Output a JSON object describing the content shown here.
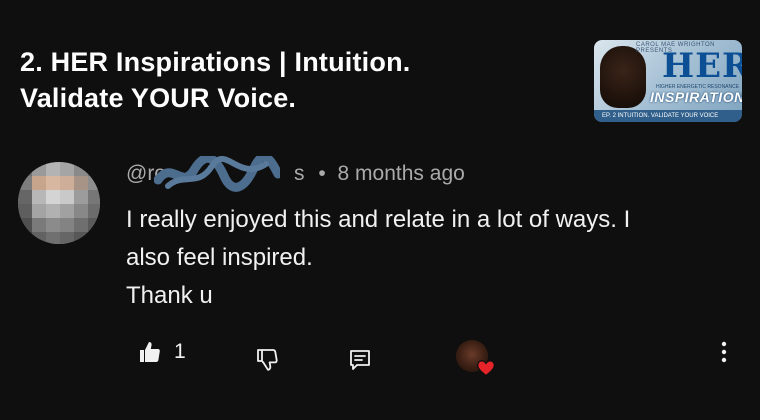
{
  "video": {
    "title_line1": "2. HER Inspirations | Intuition.",
    "title_line2": "Validate YOUR Voice.",
    "thumbnail": {
      "her": "HER",
      "tiny_text": "CAROL MAE WRIGHTON PRESENTS",
      "subtitle": "HIGHER ENERGETIC RESONANCE",
      "inspirations": "INSPIRATIONS",
      "episode_bar": "EP. 2  INTUITION. VALIDATE YOUR VOICE"
    }
  },
  "comment": {
    "handle": "@ro",
    "handle_suffix": "s",
    "separator": "•",
    "time_ago": "8 months ago",
    "line1": "I really enjoyed this and relate in a lot of ways. I",
    "line2": "also feel inspired.",
    "line3": "Thank u",
    "like_count": "1"
  },
  "icons": {
    "like": "thumbs-up-icon",
    "dislike": "thumbs-down-icon",
    "reply": "reply-icon",
    "creator_heart": "creator-heart-icon",
    "more": "more-vertical-icon"
  },
  "colors": {
    "background": "#0f0f0f",
    "text_primary": "#f1f1f1",
    "text_secondary": "#aaaaaa",
    "heart": "#e5242a",
    "scribble": "#4d6d8e"
  }
}
